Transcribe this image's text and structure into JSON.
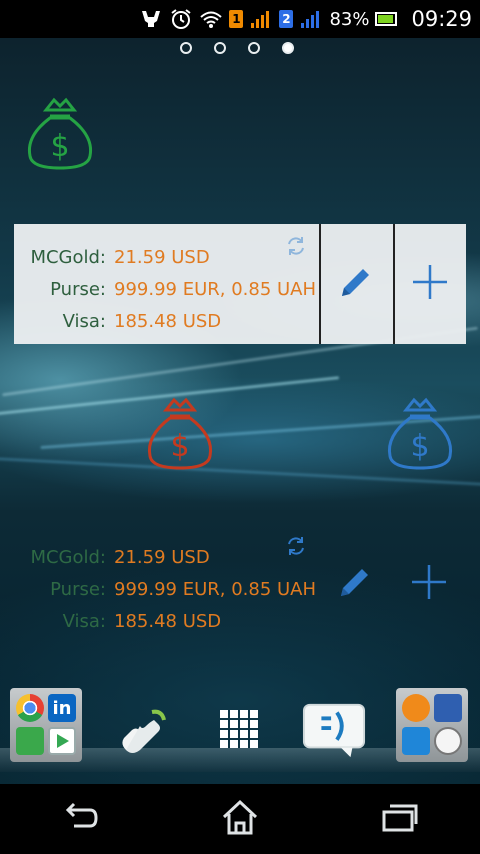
{
  "status_bar": {
    "sim1_badge": "1",
    "sim2_badge": "2",
    "battery_text": "83%",
    "battery_level": 0.83,
    "time": "09:29",
    "icons": [
      "usb-icon",
      "alarm-icon",
      "wifi-icon",
      "signal-icon",
      "battery-icon"
    ]
  },
  "pager": {
    "pages": 4,
    "active_index": 3
  },
  "colors": {
    "label_green": "#2e5f3e",
    "value_orange": "#e07b21",
    "action_blue": "#2f79c9",
    "bag_green": "#25a344",
    "bag_red": "#c43a1f",
    "bag_blue": "#2f79c9"
  },
  "widget_main": {
    "rows": [
      {
        "label": "MCGold:",
        "value": "21.59 USD"
      },
      {
        "label": "Purse:",
        "value": "999.99 EUR, 0.85 UAH"
      },
      {
        "label": "Visa:",
        "value": "185.48 USD"
      }
    ]
  },
  "widget_secondary": {
    "rows": [
      {
        "label": "MCGold:",
        "value": "21.59 USD"
      },
      {
        "label": "Purse:",
        "value": "999.99 EUR, 0.85 UAH"
      },
      {
        "label": "Visa:",
        "value": "185.48 USD"
      }
    ]
  },
  "dock": {
    "left_folder_apps": [
      "chrome-icon",
      "linkedin-icon",
      "share-icon",
      "play-store-icon"
    ],
    "apps": [
      "phone-icon",
      "apps-grid-icon",
      "messaging-icon"
    ],
    "right_folder_apps": [
      "gallery-icon",
      "save-icon",
      "search-icon",
      "clock-icon"
    ]
  },
  "nav": [
    "back-icon",
    "home-icon",
    "recents-icon"
  ]
}
